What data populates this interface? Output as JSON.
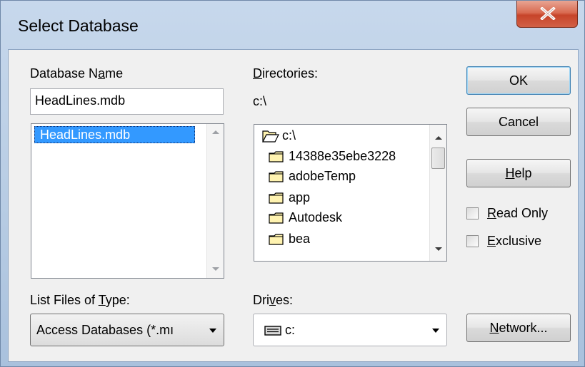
{
  "window": {
    "title": "Select Database"
  },
  "db_name": {
    "label_pre": "Database N",
    "label_mn": "a",
    "label_post": "me",
    "value": "HeadLines.mdb",
    "files": [
      "HeadLines.mdb"
    ]
  },
  "directories": {
    "label_mn": "D",
    "label_rest": "irectories:",
    "current": "c:\\",
    "items": [
      {
        "name": "c:\\",
        "open": true
      },
      {
        "name": "14388e35ebe3228",
        "open": false
      },
      {
        "name": "adobeTemp",
        "open": false
      },
      {
        "name": "app",
        "open": false
      },
      {
        "name": "Autodesk",
        "open": false
      },
      {
        "name": "bea",
        "open": false
      }
    ]
  },
  "file_type": {
    "label_pre": "List Files of ",
    "label_mn": "T",
    "label_post": "ype:",
    "value": "Access Databases (*.mı"
  },
  "drives": {
    "label_pre": "Dri",
    "label_mn": "v",
    "label_post": "es:",
    "value": "c:"
  },
  "buttons": {
    "ok": "OK",
    "cancel": "Cancel",
    "help_mn": "H",
    "help_rest": "elp",
    "network_mn": "N",
    "network_rest": "etwork..."
  },
  "options": {
    "read_only_mn": "R",
    "read_only_rest": "ead Only",
    "exclusive_mn": "E",
    "exclusive_rest": "xclusive",
    "read_only_checked": false,
    "exclusive_checked": false
  },
  "icons": {
    "close": "close-x-icon",
    "folder_open": "folder-open-icon",
    "folder": "folder-icon",
    "drive": "drive-icon"
  },
  "colors": {
    "selection": "#3399ff",
    "close_button": "#c7442a",
    "folder_fill": "#fff3b0"
  }
}
